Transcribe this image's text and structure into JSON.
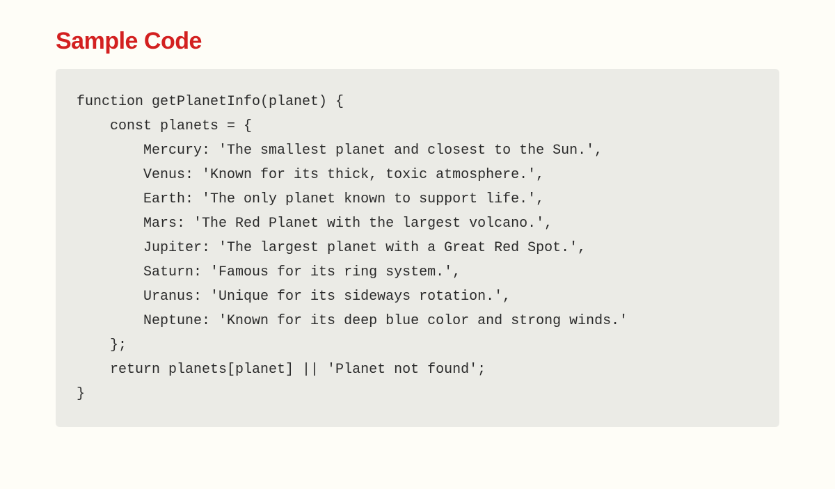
{
  "heading": "Sample Code",
  "code": "function getPlanetInfo(planet) {\n    const planets = {\n        Mercury: 'The smallest planet and closest to the Sun.',\n        Venus: 'Known for its thick, toxic atmosphere.',\n        Earth: 'The only planet known to support life.',\n        Mars: 'The Red Planet with the largest volcano.',\n        Jupiter: 'The largest planet with a Great Red Spot.',\n        Saturn: 'Famous for its ring system.',\n        Uranus: 'Unique for its sideways rotation.',\n        Neptune: 'Known for its deep blue color and strong winds.'\n    };\n    return planets[planet] || 'Planet not found';\n}"
}
